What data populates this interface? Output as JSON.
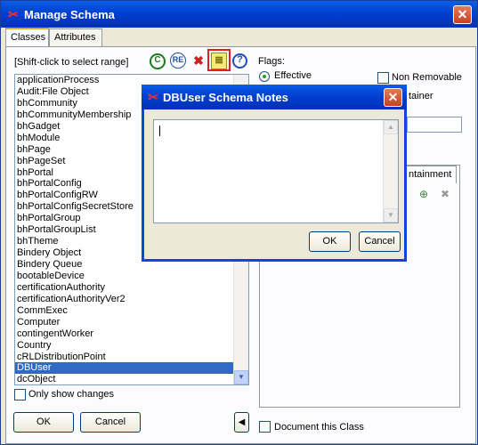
{
  "window": {
    "title": "Manage Schema",
    "close_glyph": "✕"
  },
  "tabs": [
    {
      "label": "Classes"
    },
    {
      "label": "Attributes"
    }
  ],
  "classes": {
    "hint": "[Shift-click to select range]",
    "items": [
      "applicationProcess",
      "Audit:File Object",
      "bhCommunity",
      "bhCommunityMembership",
      "bhGadget",
      "bhModule",
      "bhPage",
      "bhPageSet",
      "bhPortal",
      "bhPortalConfig",
      "bhPortalConfigRW",
      "bhPortalConfigSecretStore",
      "bhPortalGroup",
      "bhPortalGroupList",
      "bhTheme",
      "Bindery Object",
      "Bindery Queue",
      "bootableDevice",
      "certificationAuthority",
      "certificationAuthorityVer2",
      "CommExec",
      "Computer",
      "contingentWorker",
      "Country",
      "cRLDistributionPoint",
      "DBUser",
      "dcObject"
    ],
    "selected_index": 25,
    "only_changes_label": "Only show changes"
  },
  "toolbar": {
    "icons": [
      {
        "name": "add-class-icon",
        "glyph": "C"
      },
      {
        "name": "rename-class-icon",
        "glyph": "RE"
      },
      {
        "name": "delete-class-icon",
        "glyph": "✖"
      },
      {
        "name": "notes-icon",
        "glyph": "≣"
      },
      {
        "name": "help-icon",
        "glyph": "?"
      }
    ]
  },
  "flags": {
    "label": "Flags:",
    "effective_label": "Effective",
    "non_removable_label": "Non Removable",
    "container_label": "tainer",
    "containment_tab_label": "ntainment"
  },
  "document_class_label": "Document this Class",
  "ok_label": "OK",
  "cancel_label": "Cancel",
  "collapse_glyph": "◀",
  "notes_dialog": {
    "title": "DBUser Schema Notes",
    "value": "",
    "ok_label": "OK",
    "cancel_label": "Cancel"
  },
  "colors": {
    "selection": "#316ac5",
    "titlebar": "#0040d0",
    "highlight_border": "#e02020"
  }
}
